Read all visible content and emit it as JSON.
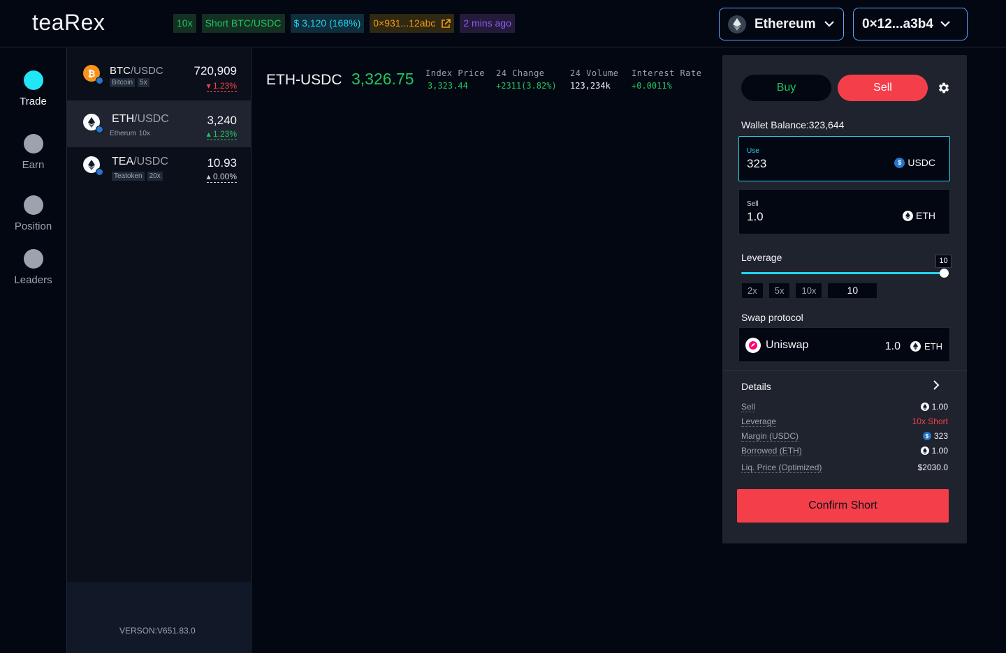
{
  "header": {
    "logo": "teaRex",
    "chips": {
      "leverage": "10x",
      "position": "Short BTC/USDC",
      "pnl": "$ 3,120 (168%)",
      "tx_address": "0×931...12abc",
      "time": "2 mins ago"
    },
    "network": "Ethereum",
    "wallet": "0×12...a3b4"
  },
  "sidebar": {
    "items": [
      {
        "label": "Trade",
        "active": true
      },
      {
        "label": "Earn",
        "active": false
      },
      {
        "label": "Position",
        "active": false
      },
      {
        "label": "Leaders",
        "active": false
      }
    ]
  },
  "markets": {
    "items": [
      {
        "base": "BTC",
        "quote": "/USDC",
        "tag": "Bitcoin",
        "leverage": "5x",
        "price": "720,909",
        "change": "▾ 1.23%",
        "direction": "down",
        "icon": "bitcoin-icon"
      },
      {
        "base": "ETH",
        "quote": "/USDC",
        "tag": "Etherum",
        "leverage": "10x",
        "price": "3,240",
        "change": "▴ 1.23%",
        "direction": "up",
        "icon": "ethereum-icon"
      },
      {
        "base": "TEA",
        "quote": "/USDC",
        "tag": "Teatoken",
        "leverage": "20x",
        "price": "10.93",
        "change": "▴ 0.00%",
        "direction": "flat",
        "icon": "ethereum-icon"
      }
    ],
    "version": "VERSON:V651.83.0"
  },
  "ticker": {
    "symbol": "ETH-USDC",
    "last_price": "3,326.75",
    "stats": [
      {
        "label": "Index Price",
        "value": "3,323.44",
        "color": "#22c55e"
      },
      {
        "label": "24 Change",
        "value": "+2311(3.82%)",
        "color": "#22c55e"
      },
      {
        "label": "24 Volume",
        "value": "123,234k",
        "color": "#f3f4f6"
      },
      {
        "label": "Interest Rate",
        "value": "+0.0011%",
        "color": "#22c55e"
      }
    ]
  },
  "trade": {
    "buy_label": "Buy",
    "sell_label": "Sell",
    "wallet_balance": "Wallet Balance:323,644",
    "use": {
      "label": "Use",
      "value": "323",
      "token": "USDC"
    },
    "sell": {
      "label": "Sell",
      "value": "1.0",
      "token": "ETH"
    },
    "leverage": {
      "label": "Leverage",
      "value": "10",
      "level": 1.0,
      "presets": [
        "2x",
        "5x",
        "10x"
      ],
      "input": "10"
    },
    "swap": {
      "label": "Swap protocol",
      "name": "Uniswap",
      "amount": "1.0",
      "token": "ETH"
    },
    "details": {
      "label": "Details",
      "rows": [
        {
          "key": "Sell",
          "value": "1.00",
          "icon": "eth"
        },
        {
          "key": "Leverage",
          "value": "10x Short",
          "icon": ""
        },
        {
          "key": "Margin (USDC)",
          "value": "323",
          "icon": "usdc"
        },
        {
          "key": "Borrowed (ETH)",
          "value": "1.00",
          "icon": "eth"
        },
        {
          "key": "Liq. Price (Optimized)",
          "value": "$2030.0",
          "icon": ""
        }
      ]
    },
    "confirm_label": "Confirm Short"
  },
  "colors": {
    "accent": "#22d3ee",
    "buy": "#22c55e",
    "sell": "#f43f4a"
  }
}
